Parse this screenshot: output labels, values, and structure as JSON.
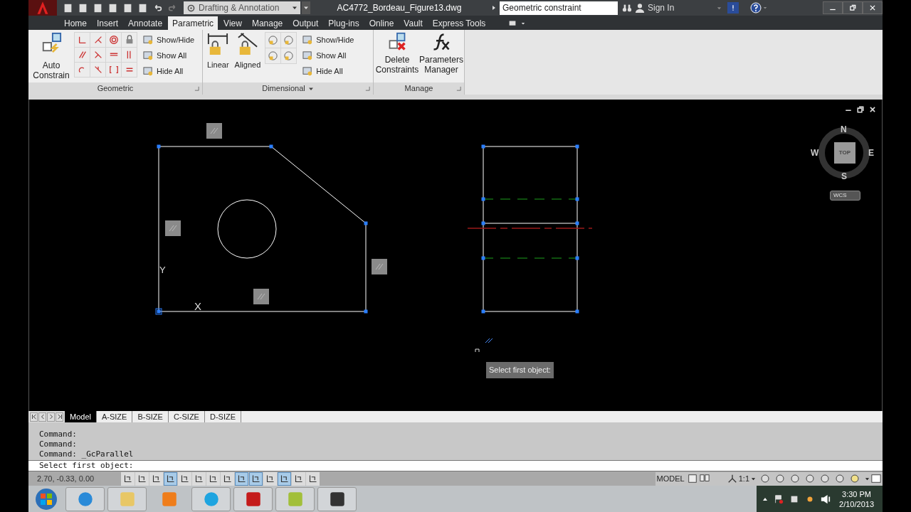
{
  "title_bar": {
    "workspace": "Drafting & Annotation",
    "file_title": "AC4772_Bordeau_Figure13.dwg",
    "search": {
      "value": "Geometric constraint"
    },
    "sign_in": "Sign In"
  },
  "ribbon_tabs": [
    {
      "label": "Home",
      "selected": false
    },
    {
      "label": "Insert",
      "selected": false
    },
    {
      "label": "Annotate",
      "selected": false
    },
    {
      "label": "Parametric",
      "selected": true
    },
    {
      "label": "View",
      "selected": false
    },
    {
      "label": "Manage",
      "selected": false
    },
    {
      "label": "Output",
      "selected": false
    },
    {
      "label": "Plug-ins",
      "selected": false
    },
    {
      "label": "Online",
      "selected": false
    },
    {
      "label": "Vault",
      "selected": false
    },
    {
      "label": "Express Tools",
      "selected": false
    }
  ],
  "geometric_panel": {
    "title": "Geometric",
    "auto_constrain": "Auto Constrain",
    "display_buttons": [
      "Show/Hide",
      "Show All",
      "Hide All"
    ]
  },
  "dimensional_panel": {
    "title": "Dimensional",
    "large_buttons": [
      "Linear",
      "Aligned"
    ],
    "display_buttons": [
      "Show/Hide",
      "Show All",
      "Hide All"
    ]
  },
  "manage_panel": {
    "title": "Manage",
    "buttons": [
      "Delete Constraints",
      "Parameters Manager"
    ]
  },
  "viewcube": {
    "north": "N",
    "south": "S",
    "east": "E",
    "west": "W",
    "face": "TOP",
    "coordinate_system": "WCS"
  },
  "canvas": {
    "ucs_y": "Y",
    "ucs_x": "X",
    "tooltip": "Select first object:"
  },
  "layout_tabs": [
    {
      "label": "Model",
      "selected": true
    },
    {
      "label": "A-SIZE",
      "selected": false
    },
    {
      "label": "B-SIZE",
      "selected": false
    },
    {
      "label": "C-SIZE",
      "selected": false
    },
    {
      "label": "D-SIZE",
      "selected": false
    }
  ],
  "command_history": [
    "Command:",
    "Command:",
    "Command: _GcParallel"
  ],
  "command_input": {
    "value": "Select first object:"
  },
  "status_bar": {
    "coordinates": "2.70, -0.33, 0.00",
    "toggles": [
      {
        "on": false
      },
      {
        "on": false
      },
      {
        "on": false
      },
      {
        "on": true
      },
      {
        "on": false
      },
      {
        "on": false
      },
      {
        "on": false
      },
      {
        "on": false
      },
      {
        "on": true
      },
      {
        "on": true
      },
      {
        "on": false
      },
      {
        "on": true
      },
      {
        "on": false
      },
      {
        "on": false
      }
    ],
    "space": "MODEL",
    "scale": "1:1"
  },
  "taskbar": {
    "time": "3:30 PM",
    "date": "2/10/2013"
  }
}
